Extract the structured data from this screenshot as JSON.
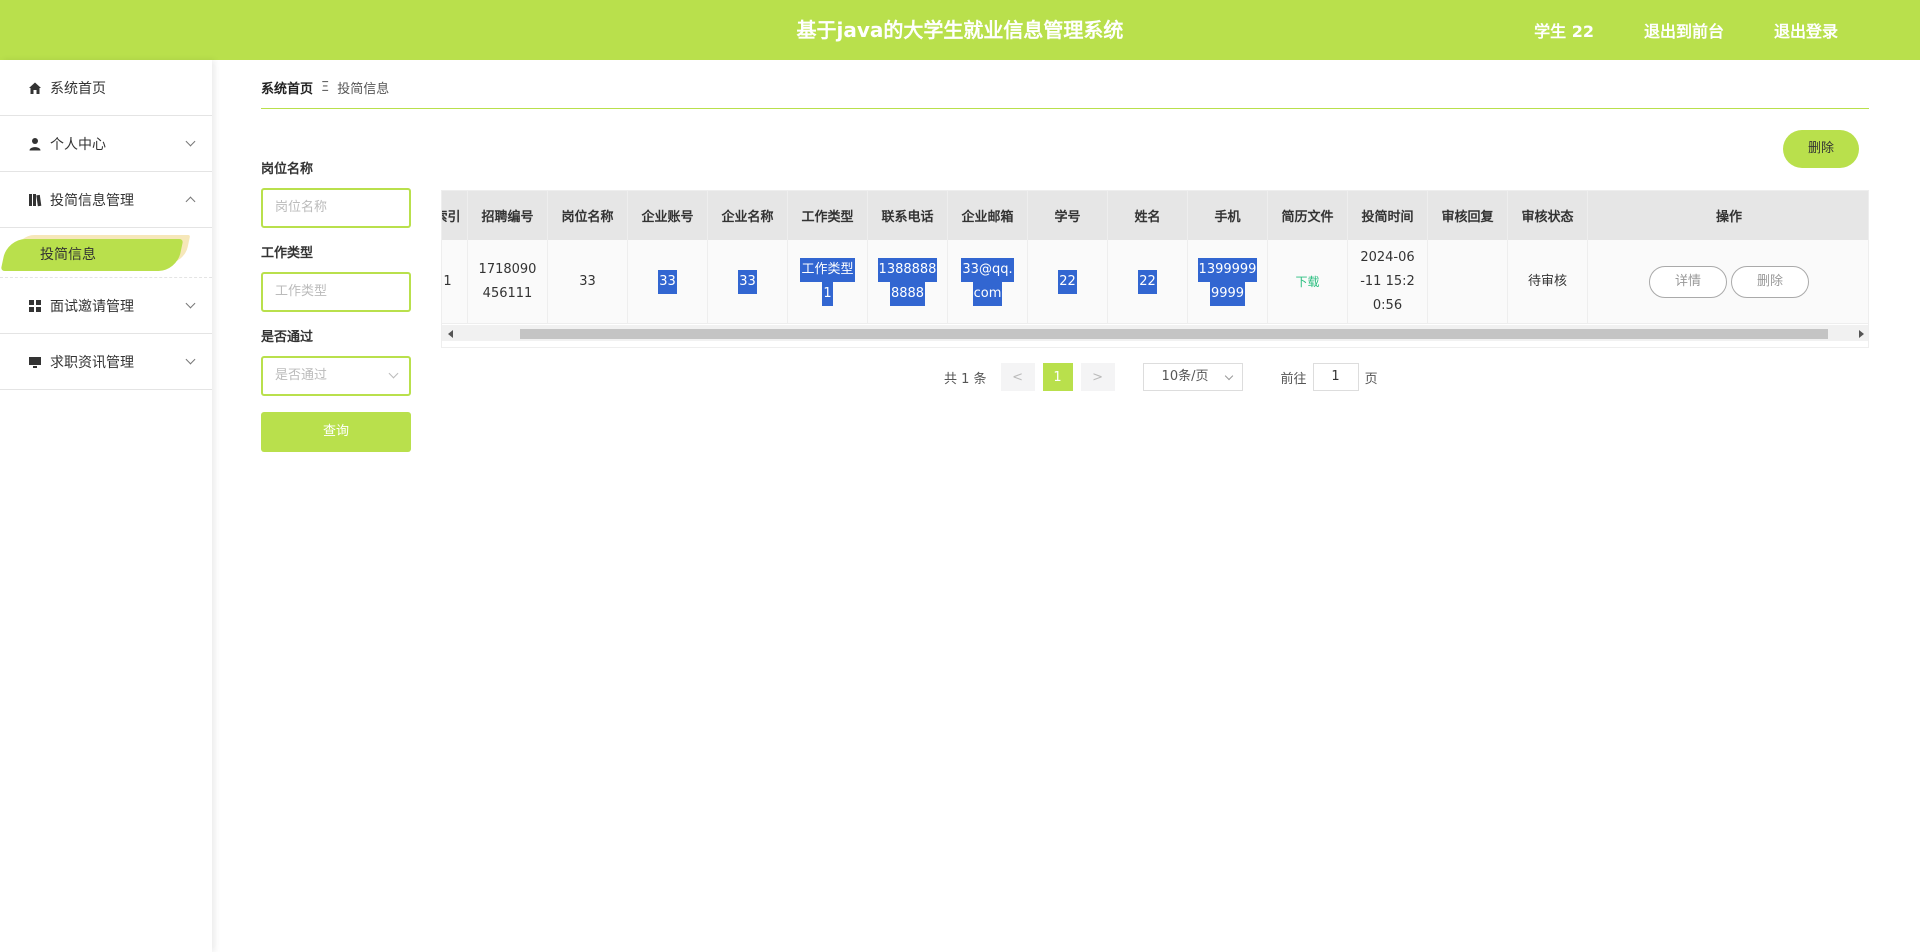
{
  "header": {
    "title": "基于java的大学生就业信息管理系统",
    "user": "学生 22",
    "front": "退出到前台",
    "logout": "退出登录"
  },
  "sidebar": {
    "items": [
      {
        "label": "系统首页",
        "icon": "home-icon"
      },
      {
        "label": "个人中心",
        "icon": "user-icon"
      },
      {
        "label": "投简信息管理",
        "icon": "book-icon"
      },
      {
        "label": "面试邀请管理",
        "icon": "grid-icon"
      },
      {
        "label": "求职资讯管理",
        "icon": "monitor-icon"
      }
    ],
    "active_sub": "投简信息"
  },
  "breadcrumb": {
    "home": "系统首页",
    "sep": "Ξ",
    "current": "投简信息"
  },
  "toolbar": {
    "delete_label": "删除"
  },
  "filter": {
    "position_label": "岗位名称",
    "position_placeholder": "岗位名称",
    "type_label": "工作类型",
    "type_placeholder": "工作类型",
    "pass_label": "是否通过",
    "pass_placeholder": "是否通过",
    "query_label": "查询"
  },
  "table": {
    "headers": [
      "索引",
      "招聘编号",
      "岗位名称",
      "企业账号",
      "企业名称",
      "工作类型",
      "联系电话",
      "企业邮箱",
      "学号",
      "姓名",
      "手机",
      "简历文件",
      "投简时间",
      "审核回复",
      "审核状态",
      "操作"
    ],
    "row": {
      "index": "1",
      "job_no_a": "1718090",
      "job_no_b": "456111",
      "position": "33",
      "company_account": "33",
      "company_name": "33",
      "work_type_a": "工作类型",
      "work_type_b": "1",
      "phone_a": "1388888",
      "phone_b": "8888",
      "email_a": "33@qq.",
      "email_b": "com",
      "student_no": "22",
      "name": "22",
      "mobile_a": "1399999",
      "mobile_b": "9999",
      "resume": "下载",
      "time_a": "2024-06",
      "time_b": "-11 15:2",
      "time_c": "0:56",
      "reply": "",
      "status": "待审核",
      "detail_label": "详情",
      "delete_label": "删除"
    }
  },
  "pager": {
    "total": "共 1 条",
    "prev": "<",
    "page": "1",
    "next": ">",
    "size": "10条/页",
    "goto": "前往",
    "goto_value": "1",
    "unit": "页"
  }
}
